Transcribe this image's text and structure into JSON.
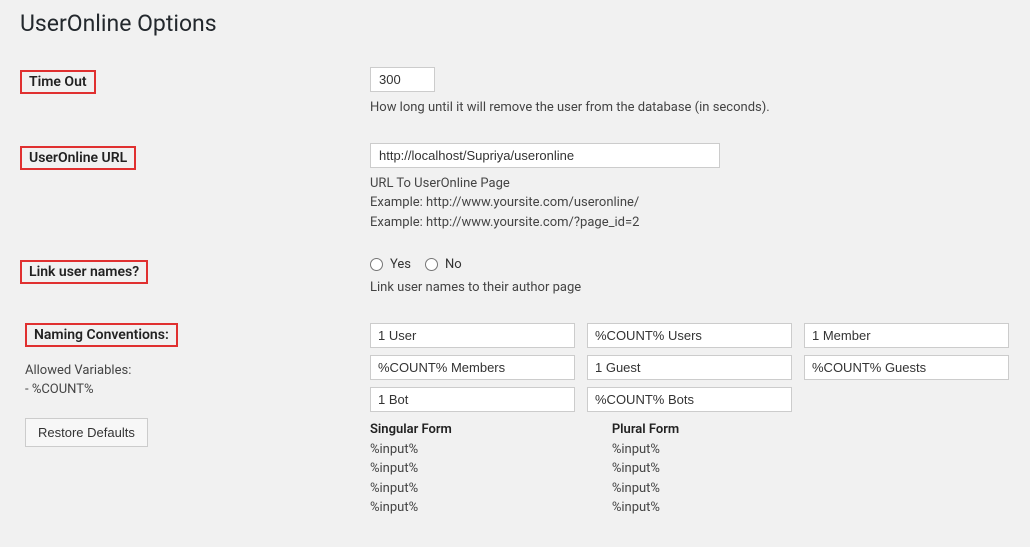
{
  "page_title": "UserOnline Options",
  "timeout": {
    "label": "Time Out",
    "value": "300",
    "desc": "How long until it will remove the user from the database (in seconds)."
  },
  "url": {
    "label": "UserOnline URL",
    "value": "http://localhost/Supriya/useronline",
    "desc_line1": "URL To UserOnline Page",
    "desc_line2": "Example: http://www.yoursite.com/useronline/",
    "desc_line3": "Example: http://www.yoursite.com/?page_id=2"
  },
  "link_names": {
    "label": "Link user names?",
    "yes_label": "Yes",
    "no_label": "No",
    "desc": "Link user names to their author page"
  },
  "naming": {
    "label": "Naming Conventions:",
    "allowed_label": "Allowed Variables:",
    "allowed_var": "- %COUNT%",
    "restore_label": "Restore Defaults",
    "grid": {
      "r0c0": "1 User",
      "r0c1": "%COUNT% Users",
      "r0c2": "1 Member",
      "r1c0": "%COUNT% Members",
      "r1c1": "1 Guest",
      "r1c2": "%COUNT% Guests",
      "r2c0": "1 Bot",
      "r2c1": "%COUNT% Bots"
    },
    "singular_heading": "Singular Form",
    "plural_heading": "Plural Form",
    "singular": {
      "l0": "%input%",
      "l1": "%input%",
      "l2": "%input%",
      "l3": "%input%"
    },
    "plural": {
      "l0": "%input%",
      "l1": "%input%",
      "l2": "%input%",
      "l3": "%input%"
    }
  }
}
